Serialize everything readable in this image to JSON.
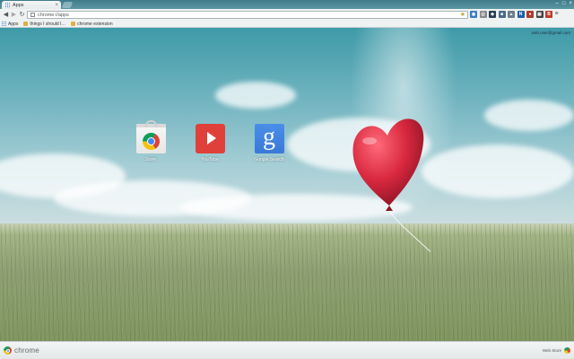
{
  "tab": {
    "title": "Apps",
    "icon": "apps-grid-icon"
  },
  "omnibox": {
    "url": "chrome://apps"
  },
  "bookmarks": {
    "apps_label": "Apps",
    "items": [
      {
        "label": "things I should l…",
        "icon": "folder-icon"
      },
      {
        "label": "chrome extension",
        "icon": "bookmark-icon"
      }
    ]
  },
  "extensions": [
    {
      "icon": "ext-1-icon",
      "glyph": "◉",
      "color": "#3a79c6"
    },
    {
      "icon": "ext-2-icon",
      "glyph": "◎",
      "color": "#8a8a8a"
    },
    {
      "icon": "ext-3-icon",
      "glyph": "◆",
      "color": "#2c3e50"
    },
    {
      "icon": "ext-4-icon",
      "glyph": "■",
      "color": "#4b6a88"
    },
    {
      "icon": "ext-5-icon",
      "glyph": "▲",
      "color": "#6b7d8a"
    },
    {
      "icon": "ext-6-icon",
      "glyph": "N",
      "color": "#1f5fa8"
    },
    {
      "icon": "ext-7-icon",
      "glyph": "●",
      "color": "#b03a2e"
    },
    {
      "icon": "ext-8-icon",
      "glyph": "▣",
      "color": "#444444"
    },
    {
      "icon": "ext-9-icon",
      "glyph": "B",
      "color": "#c0392b"
    }
  ],
  "account": {
    "email": "web.user@gmail.com"
  },
  "apps": [
    {
      "name": "Store",
      "icon": "chrome-web-store-icon"
    },
    {
      "name": "YouTube",
      "icon": "youtube-icon"
    },
    {
      "name": "Google Search",
      "icon": "google-search-icon",
      "glyph": "g"
    }
  ],
  "footer": {
    "brand": "chrome",
    "webstore_label": "Web Store"
  },
  "colors": {
    "youtube_red": "#e0403a",
    "google_blue": "#3b78d8",
    "balloon_red": "#d8283e"
  }
}
